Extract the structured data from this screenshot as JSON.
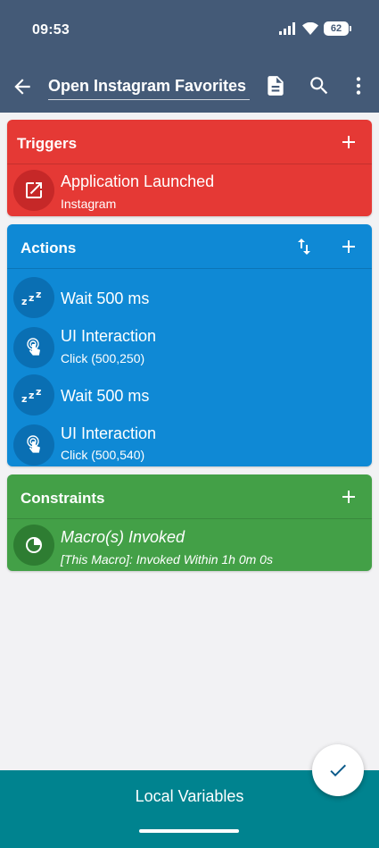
{
  "status_bar": {
    "time": "09:53",
    "battery": "62"
  },
  "toolbar": {
    "macro_name": "Open Instagram Favorites"
  },
  "triggers": {
    "title": "Triggers",
    "items": [
      {
        "title": "Application Launched",
        "subtitle": "Instagram"
      }
    ]
  },
  "actions": {
    "title": "Actions",
    "items": [
      {
        "title": "Wait 500 ms"
      },
      {
        "title": "UI Interaction",
        "subtitle": "Click (500,250)"
      },
      {
        "title": "Wait 500 ms"
      },
      {
        "title": "UI Interaction",
        "subtitle": "Click (500,540)"
      }
    ]
  },
  "constraints": {
    "title": "Constraints",
    "items": [
      {
        "title": "Macro(s) Invoked",
        "subtitle": "[This Macro]: Invoked Within 1h 0m 0s"
      }
    ]
  },
  "bottom_bar": {
    "label": "Local Variables"
  },
  "colors": {
    "header": "#445a77",
    "triggers": "#e53935",
    "actions": "#0f89d5",
    "constraints": "#43a047",
    "bottom_bar": "#00838f"
  },
  "icons": {
    "status": [
      "signal-icon",
      "wifi-icon",
      "battery-icon"
    ],
    "toolbar": [
      "back-arrow-icon",
      "document-icon",
      "search-icon",
      "more-vert-icon"
    ],
    "items": [
      "open-in-new-icon",
      "sleep-icon",
      "touch-icon",
      "sleep-icon",
      "touch-icon",
      "timer-icon"
    ],
    "fab": "check-icon"
  }
}
